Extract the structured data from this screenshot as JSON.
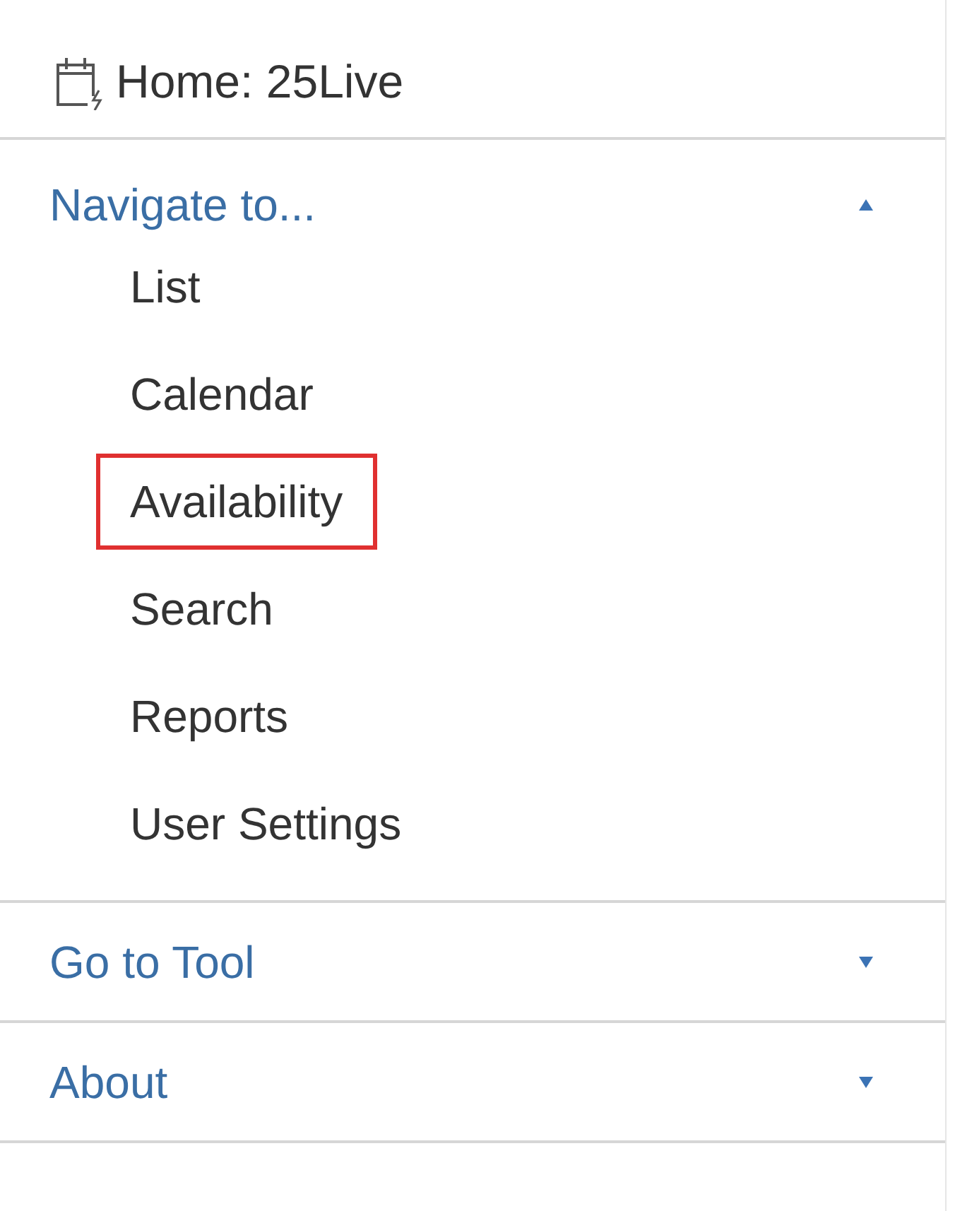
{
  "home": {
    "label": "Home: 25Live"
  },
  "sections": [
    {
      "label": "Navigate to...",
      "expanded": true,
      "items": [
        {
          "label": "List",
          "highlighted": false
        },
        {
          "label": "Calendar",
          "highlighted": false
        },
        {
          "label": "Availability",
          "highlighted": true
        },
        {
          "label": "Search",
          "highlighted": false
        },
        {
          "label": "Reports",
          "highlighted": false
        },
        {
          "label": "User Settings",
          "highlighted": false
        }
      ]
    },
    {
      "label": "Go to Tool",
      "expanded": false
    },
    {
      "label": "About",
      "expanded": false
    }
  ]
}
